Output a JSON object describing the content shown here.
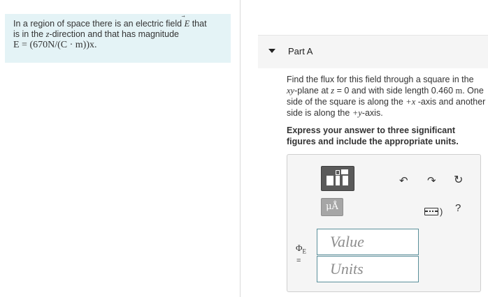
{
  "problem": {
    "text_before_E": "In a region of space there is an electric field ",
    "E_symbol": "E",
    "text_line1_end": " that",
    "text_line2_a": "is in the ",
    "z_var": "z",
    "text_line2_b": "-direction and that has magnitude",
    "equation": "E = (670N/(C · m))x."
  },
  "part": {
    "title": "Part A",
    "question": {
      "a": "Find the flux for this field through a square in the ",
      "plane": "xy",
      "b": "-plane at ",
      "cond": "z",
      "c": " = 0 and with side length 0.460 ",
      "unit": "m",
      "d": ". One side of the square is along the ",
      "axis1": "+x",
      "e": " -axis and another side is along the ",
      "axis2": "+y",
      "f": "-axis."
    },
    "instruction": "Express your answer to three significant figures and include the appropriate units."
  },
  "answer": {
    "symbol": "Φ",
    "symbol_sub": "E",
    "equals": "=",
    "value_placeholder": "Value",
    "units_placeholder": "Units",
    "units_button_label": "μÅ",
    "help_label": "?",
    "icons": [
      "templates-icon",
      "units-icon",
      "undo-icon",
      "redo-icon",
      "reset-icon",
      "keyboard-icon",
      "help-icon"
    ]
  },
  "colors": {
    "problem_bg": "#e4f3f6",
    "field_border": "#5a8f9a",
    "header_bg": "#f5f5f5"
  }
}
